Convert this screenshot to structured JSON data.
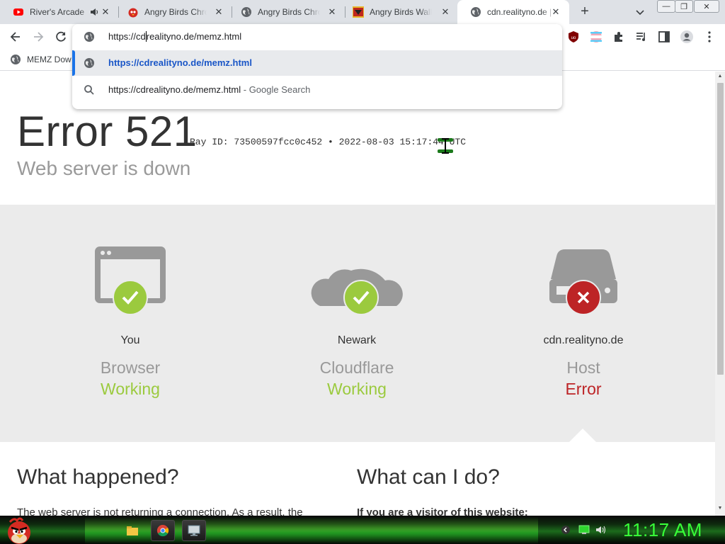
{
  "tabs": [
    {
      "title": "River's Arcade",
      "favicon": "youtube-icon",
      "has_audio": true
    },
    {
      "title": "Angry Birds Chrome",
      "favicon": "angry-bird-icon"
    },
    {
      "title": "Angry Birds Chrome",
      "favicon": "globe-icon"
    },
    {
      "title": "Angry Birds Walkthrough",
      "favicon": "angry-birds-logo-icon"
    },
    {
      "title": "cdn.realityno.de |",
      "favicon": "globe-icon",
      "active": true
    }
  ],
  "window_controls": {
    "minimize": "—",
    "restore": "❐",
    "close": "✕"
  },
  "omnibox": {
    "typed_before_caret": "https://cd",
    "typed_after_caret": "realityno.de/memz.html",
    "suggestions": [
      {
        "text": "https://cdrealityno.de/memz.html",
        "suffix": "",
        "icon": "globe-icon",
        "selected": true
      },
      {
        "text": "https://cdrealityno.de/memz.html",
        "suffix": " - Google Search",
        "icon": "search-icon",
        "selected": false
      }
    ]
  },
  "bookmarks": [
    {
      "label": "MEMZ Dow"
    }
  ],
  "page": {
    "error_title": "Error 521",
    "ray_line": "Ray ID: 73500597fcc0c452 • 2022-08-03 15:17:44 UTC",
    "error_subtitle": "Web server is down",
    "nodes": [
      {
        "location": "You",
        "kind": "Browser",
        "state": "Working",
        "ok": true,
        "icon": "browser-icon"
      },
      {
        "location": "Newark",
        "kind": "Cloudflare",
        "state": "Working",
        "ok": true,
        "icon": "cloud-icon"
      },
      {
        "location": "cdn.realityno.de",
        "kind": "Host",
        "state": "Error",
        "ok": false,
        "icon": "server-icon"
      }
    ],
    "what_happened_title": "What happened?",
    "what_happened_text": "The web server is not returning a connection. As a result, the",
    "what_can_i_do_title": "What can I do?",
    "what_can_i_do_text": "If you are a visitor of this website:"
  },
  "taskbar": {
    "clock": "11:17 AM"
  },
  "colors": {
    "ok_green": "#9bca3e",
    "error_red": "#bd2426",
    "clock_green": "#38ff38",
    "link_blue": "#1a56c7"
  }
}
